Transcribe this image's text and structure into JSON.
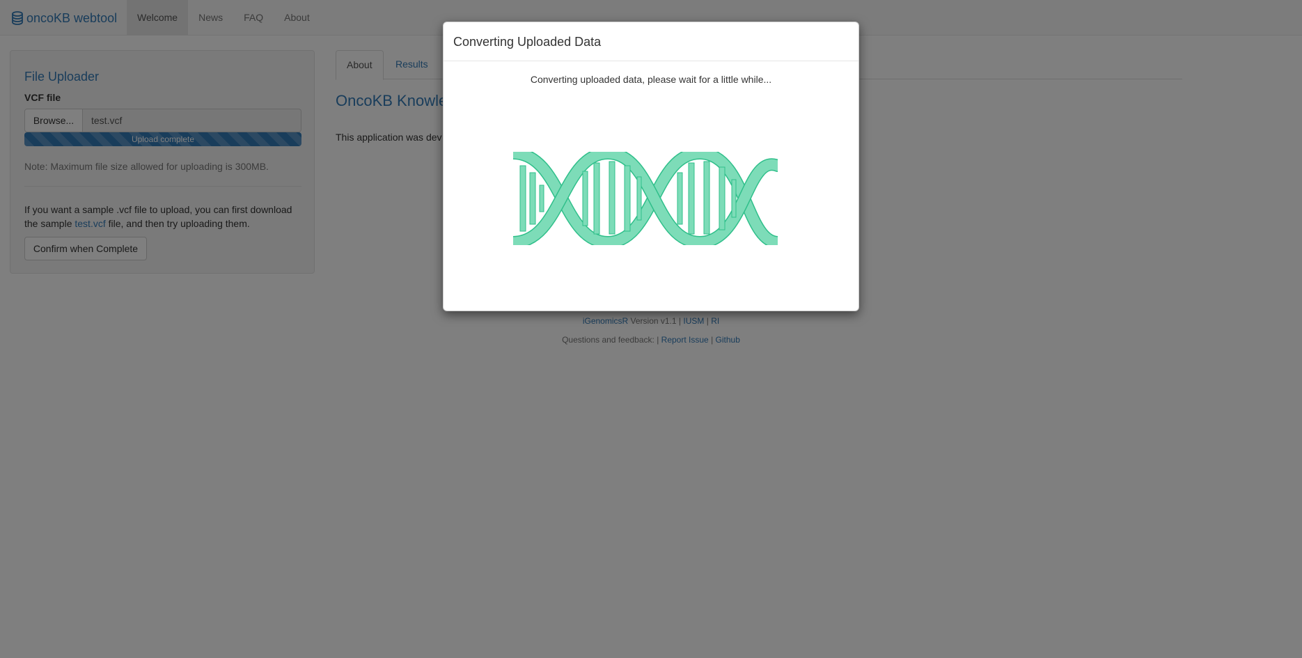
{
  "navbar": {
    "brand": "oncoKB webtool",
    "items": [
      "Welcome",
      "News",
      "FAQ",
      "About"
    ],
    "active": "Welcome"
  },
  "sidebar": {
    "title": "File Uploader",
    "file_label": "VCF file",
    "browse_label": "Browse...",
    "file_value": "test.vcf",
    "progress": {
      "text": "Upload complete",
      "fraction": 1.0
    },
    "note": "Note: Maximum file size allowed for uploading is 300MB.",
    "sample_before": "If you want a sample .vcf file to upload, you can first download the sample ",
    "sample_link": "test.vcf",
    "sample_after": " file, and then try uploading them.",
    "confirm_label": "Confirm when Complete"
  },
  "main": {
    "tabs": [
      "About",
      "Results"
    ],
    "active_tab": "About",
    "title": "OncoKB Knowle",
    "text": "This application was dev"
  },
  "footer": {
    "app_link": "iGenomicsR",
    "version": "Version v1.1",
    "sep": "|",
    "iusm": "IUSM",
    "ri": "RI",
    "questions": "Questions and feedback:",
    "report": "Report Issue",
    "github": "Github"
  },
  "modal": {
    "title": "Converting Uploaded Data",
    "message": "Converting uploaded data, please wait for a little while...",
    "icon": "dna-icon"
  },
  "colors": {
    "accent": "#337ab7",
    "dna": "#7ddcb8",
    "dna_stroke": "#2fbf8a"
  }
}
